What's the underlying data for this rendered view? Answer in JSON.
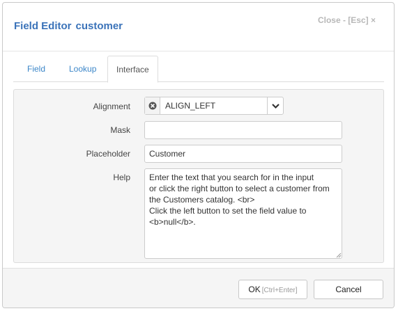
{
  "dialog": {
    "title_prefix": "Field Editor",
    "title_name": "customer",
    "close_label": "Close - [Esc] ×"
  },
  "tabs": [
    {
      "label": "Field"
    },
    {
      "label": "Lookup"
    },
    {
      "label": "Interface",
      "active": true
    }
  ],
  "form": {
    "alignment": {
      "label": "Alignment",
      "value": "ALIGN_LEFT"
    },
    "mask": {
      "label": "Mask",
      "value": ""
    },
    "placeholder": {
      "label": "Placeholder",
      "value": "Customer"
    },
    "help": {
      "label": "Help",
      "value": "Enter the text that you search for in the input\nor click the right button to select a customer from\nthe Customers catalog. <br>\nClick the left button to set the field value to\n<b>null</b>."
    }
  },
  "footer": {
    "ok_label": "OK",
    "ok_shortcut": "[Ctrl+Enter]",
    "cancel_label": "Cancel"
  },
  "colors": {
    "title": "#3b73b9",
    "tab_link": "#3b86c8",
    "panel_bg": "#f5f5f5"
  }
}
